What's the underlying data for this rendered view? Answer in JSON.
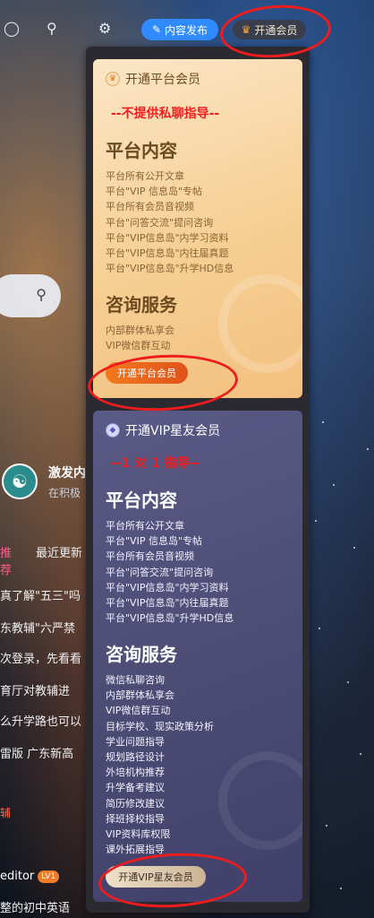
{
  "topbar": {
    "publish_label": "内容发布",
    "member_label": "开通会员",
    "icons": [
      "notification-icon",
      "search-icon",
      "settings-icon",
      "pencil-icon",
      "crown-icon"
    ]
  },
  "background_page": {
    "profile_name": "激发内",
    "profile_sub": "在积极",
    "tabs": [
      "推荐",
      "最近更新"
    ],
    "feed_items": [
      "真了解\"五三\"吗",
      "东教辅\"六严禁",
      "次登录，先看看",
      "育厅对教辅进",
      "么升学路也可以",
      "雷版 广东新高"
    ],
    "tag": "辅",
    "editor_name": "editor",
    "editor_level": "LV1",
    "last_line": "整的初中英语"
  },
  "platform_card": {
    "title": "开通平台会员",
    "notice": "--不提供私聊指导--",
    "content_title": "平台内容",
    "content_items": [
      "平台所有公开文章",
      "平台\"VIP 信息岛\"专帖",
      "平台所有会员音视频",
      "平台\"问答交流\"提问咨询",
      "平台\"VIP信息岛\"内学习资料",
      "平台\"VIP信息岛\"内往届真题",
      "平台\"VIP信息岛\"升学HD信息"
    ],
    "service_title": "咨询服务",
    "service_items": [
      "内部群体私享会",
      "VIP微信群互动"
    ],
    "cta": "开通平台会员"
  },
  "vip_card": {
    "title": "开通VIP星友会员",
    "notice": "--1 对 1 指导--",
    "content_title": "平台内容",
    "content_items": [
      "平台所有公开文章",
      "平台\"VIP 信息岛\"专帖",
      "平台所有会员音视频",
      "平台\"问答交流\"提问咨询",
      "平台\"VIP信息岛\"内学习资料",
      "平台\"VIP信息岛\"内往届真题",
      "平台\"VIP信息岛\"升学HD信息"
    ],
    "service_title": "咨询服务",
    "service_items": [
      "微信私聊咨询",
      "内部群体私享会",
      "VIP微信群互动",
      "目标学校、现实政策分析",
      "学业问题指导",
      "规划路径设计",
      "外培机构推荐",
      "升学备考建议",
      "简历修改建议",
      "择班择校指导",
      "VIP资料库权限",
      "课外拓展指导"
    ],
    "cta": "开通VIP星友会员"
  },
  "colors": {
    "accent_blue": "#2f8bff",
    "annotation_red": "#ee1c1c",
    "gold_card": "#f6cf94",
    "vip_card": "#4b4b74",
    "cta_orange": "#e0521a"
  }
}
